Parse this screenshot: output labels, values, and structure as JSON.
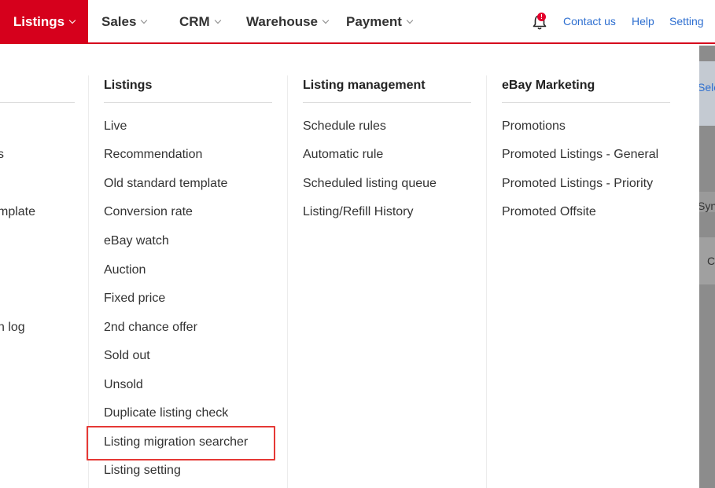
{
  "nav": {
    "items": [
      {
        "label": "Listings"
      },
      {
        "label": "Sales"
      },
      {
        "label": "CRM"
      },
      {
        "label": "Warehouse"
      },
      {
        "label": "Payment"
      }
    ],
    "notification_badge": "!",
    "links": {
      "contact": "Contact us",
      "help": "Help",
      "setting": "Setting"
    }
  },
  "dropdown": {
    "partial_column": [
      "s",
      "mplate",
      "n log"
    ],
    "columns": [
      {
        "header": "Listings",
        "items": [
          "Live",
          "Recommendation",
          "Old standard template",
          "Conversion rate",
          "eBay watch",
          "Auction",
          "Fixed price",
          "2nd chance offer",
          "Sold out",
          "Unsold",
          "Duplicate listing check",
          "Listing migration searcher",
          "Listing setting"
        ]
      },
      {
        "header": "Listing management",
        "items": [
          "Schedule rules",
          "Automatic rule",
          "Scheduled listing queue",
          "Listing/Refill History"
        ]
      },
      {
        "header": "eBay Marketing",
        "items": [
          "Promotions",
          "Promoted Listings - General",
          "Promoted Listings - Priority",
          "Promoted Offsite"
        ]
      }
    ]
  },
  "backdrop": {
    "text1": "Sele",
    "text2": "Syn",
    "text3": "C"
  },
  "colors": {
    "brand_red": "#d6001c",
    "link_blue": "#2e6fd0",
    "highlight": "#e53935"
  }
}
